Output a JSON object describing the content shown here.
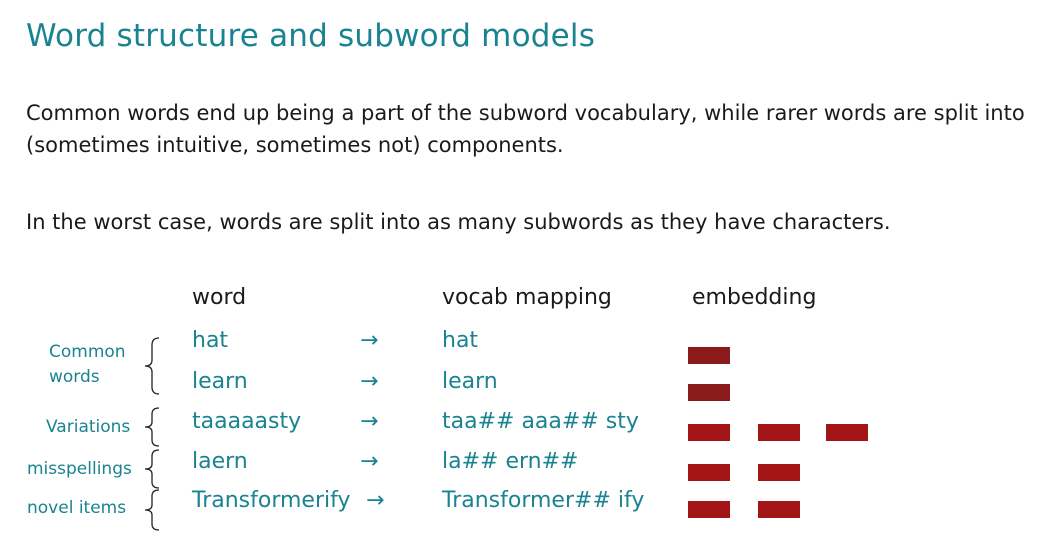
{
  "slide": {
    "title": "Word structure and subword models",
    "paragraph_1": "Common words end up being a part of the subword vocabulary, while rarer words are split into (sometimes intuitive, sometimes not) components.",
    "paragraph_2": "In the worst case, words are split into as many subwords as they have characters."
  },
  "table": {
    "headers": {
      "word": "word",
      "vocab": "vocab mapping",
      "embedding": "embedding"
    },
    "arrow": "→",
    "rows": [
      {
        "word": "hat",
        "vocab": "hat",
        "embedding_count": 1
      },
      {
        "word": "learn",
        "vocab": "learn",
        "embedding_count": 1
      },
      {
        "word": "taaaaasty",
        "vocab": "taa## aaa## sty",
        "embedding_count": 3
      },
      {
        "word": "laern",
        "vocab": "la## ern##",
        "embedding_count": 2
      },
      {
        "word": "Transformerify",
        "vocab": "Transformer## ify",
        "embedding_count": 2
      }
    ]
  },
  "categories": {
    "common_line1": "Common",
    "common_line2": "words",
    "variations": "Variations",
    "misspellings": "misspellings",
    "novel": "novel items"
  },
  "colors": {
    "teal": "#1a8391",
    "embedding_red": "#a31515",
    "embedding_dark_red": "#8b1a1a"
  }
}
